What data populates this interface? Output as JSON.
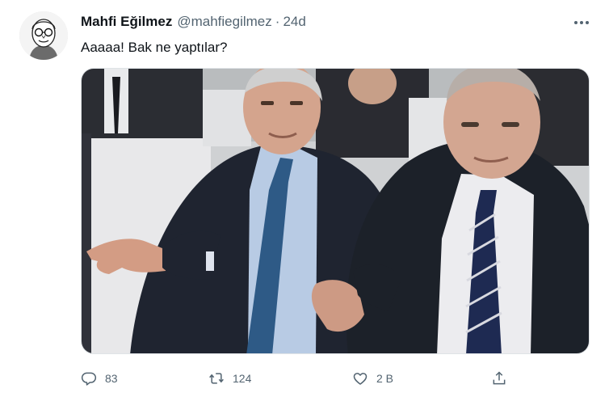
{
  "tweet": {
    "author": {
      "display_name": "Mahfi Eğilmez",
      "handle": "@mahfiegilmez",
      "separator": "·",
      "time": "24d"
    },
    "text": "Aaaaa! Bak ne yaptılar?",
    "media": {
      "icon": "photo-two-men-in-suits"
    },
    "actions": {
      "reply": {
        "icon": "reply-icon",
        "count": "83"
      },
      "retweet": {
        "icon": "retweet-icon",
        "count": "124"
      },
      "like": {
        "icon": "like-icon",
        "count": "2 B"
      },
      "share": {
        "icon": "share-icon"
      }
    },
    "menu": {
      "icon": "more-options-icon"
    }
  },
  "colors": {
    "text_primary": "#0f1419",
    "text_secondary": "#536471",
    "border": "#dfe3e6"
  }
}
